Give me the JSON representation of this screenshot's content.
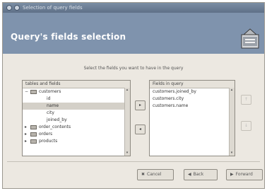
{
  "window": {
    "title": "Selection of query fields"
  },
  "header": {
    "title": "Query's fields selection"
  },
  "instruction": "Select the fields you want to have in the query",
  "tree": {
    "header": "tables and fields",
    "items": [
      {
        "label": "customers",
        "expander": "−",
        "icon": "table-icon"
      },
      {
        "label": "id"
      },
      {
        "label": "name",
        "selected": true
      },
      {
        "label": "city"
      },
      {
        "label": "joined_by"
      },
      {
        "label": "order_contents",
        "expander": "▸",
        "icon": "table-icon"
      },
      {
        "label": "orders",
        "expander": "▸",
        "icon": "table-icon"
      },
      {
        "label": "products",
        "expander": "▸",
        "icon": "table-icon"
      }
    ]
  },
  "fields": {
    "header": "Fields in query",
    "items": [
      "customers.joined_by",
      "customers.city",
      "customers.name"
    ]
  },
  "move_buttons": {
    "add": "▸",
    "remove": "◂",
    "up": "↑",
    "down": "↓"
  },
  "buttons": {
    "cancel": "Cancel",
    "back": "Back",
    "forward": "Forward"
  }
}
